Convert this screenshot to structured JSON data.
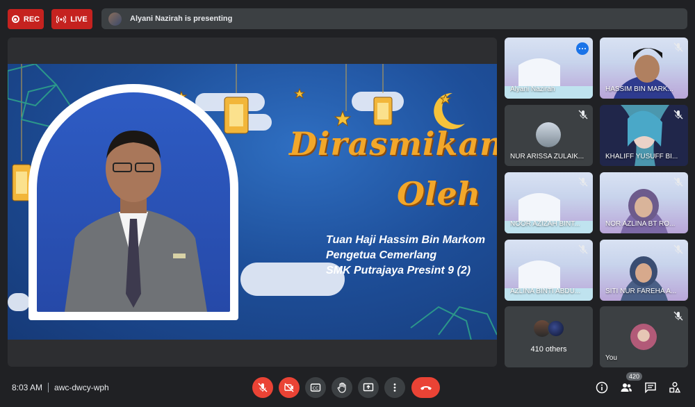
{
  "top": {
    "rec_label": "REC",
    "live_label": "LIVE",
    "presenting_text": "Alyani Nazirah is presenting"
  },
  "slide": {
    "title_line1": "Dirasmikan",
    "title_line2": "Oleh",
    "name": "Tuan Haji Hassim Bin Markom",
    "role": "Pengetua Cemerlang",
    "school": "SMK Putrajaya Presint 9 (2)"
  },
  "participants": [
    {
      "name": "Alyani Nazirah",
      "muted": false,
      "more_menu": true
    },
    {
      "name": "HASSIM BIN MARK...",
      "muted": true
    },
    {
      "name": "NUR ARISSA ZULAIK...",
      "muted": true
    },
    {
      "name": "KHALIFF YUSUFF BI...",
      "muted": true
    },
    {
      "name": "NOOR AZIZAH BINT...",
      "muted": true
    },
    {
      "name": "NOR AZLINA BT RO...",
      "muted": true
    },
    {
      "name": "AZLINA BINTI ABDU...",
      "muted": true
    },
    {
      "name": "SITI NUR FAREHA A...",
      "muted": true
    }
  ],
  "others_label": "410 others",
  "you_label": "You",
  "bottom": {
    "time": "8:03 AM",
    "meeting_code": "awc-dwcy-wph",
    "people_count": "420"
  },
  "colors": {
    "background": "#202124",
    "tile": "#3c4043",
    "danger": "#ea4335",
    "rec": "#c5221f",
    "accent": "#1a73e8",
    "slide_title": "#f2a72a"
  },
  "icons": [
    "record-icon",
    "live-icon",
    "mic-off-icon",
    "camera-off-icon",
    "captions-icon",
    "raise-hand-icon",
    "present-icon",
    "more-options-icon",
    "end-call-icon",
    "info-icon",
    "people-icon",
    "chat-icon",
    "activities-icon"
  ]
}
